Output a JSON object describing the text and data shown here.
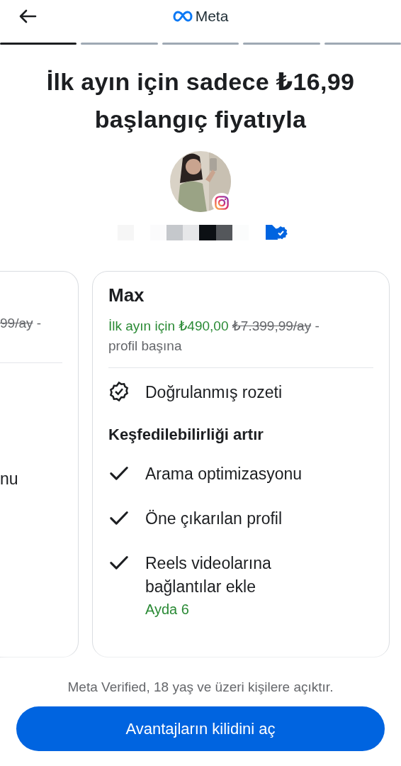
{
  "header": {
    "brand": "Meta"
  },
  "steps": [
    {
      "selected": true
    },
    {
      "selected": false
    },
    {
      "selected": false
    },
    {
      "selected": false
    },
    {
      "selected": false
    }
  ],
  "title": "İlk ayın için sadece ₺16,99 başlangıç fiyatıyla",
  "profile": {
    "verified": true
  },
  "plans": [
    {
      "kind": "partial",
      "old_price": "99/ay",
      "suffix": "-",
      "feature_tail": "nu"
    },
    {
      "kind": "full",
      "name": "Max",
      "price": "İlk ayın için ₺490,00",
      "old_price": "₺7.399,99/ay",
      "suffix": "-",
      "per": "profil başına",
      "features": [
        {
          "kind": "badge",
          "label": "Doğrulanmış rozeti"
        },
        {
          "kind": "heading",
          "label": "Keşfedilebilirliği artır"
        },
        {
          "kind": "check",
          "label": "Arama optimizasyonu"
        },
        {
          "kind": "check",
          "label": "Öne çıkarılan profil"
        },
        {
          "kind": "check",
          "label": "Reels videolarına bağlantılar ekle",
          "note": "Ayda 6"
        }
      ]
    }
  ],
  "footer": {
    "note": "Meta Verified, 18 yaş ve üzeri kişilere açıktır.",
    "button": "Avantajların kilidini aç"
  }
}
